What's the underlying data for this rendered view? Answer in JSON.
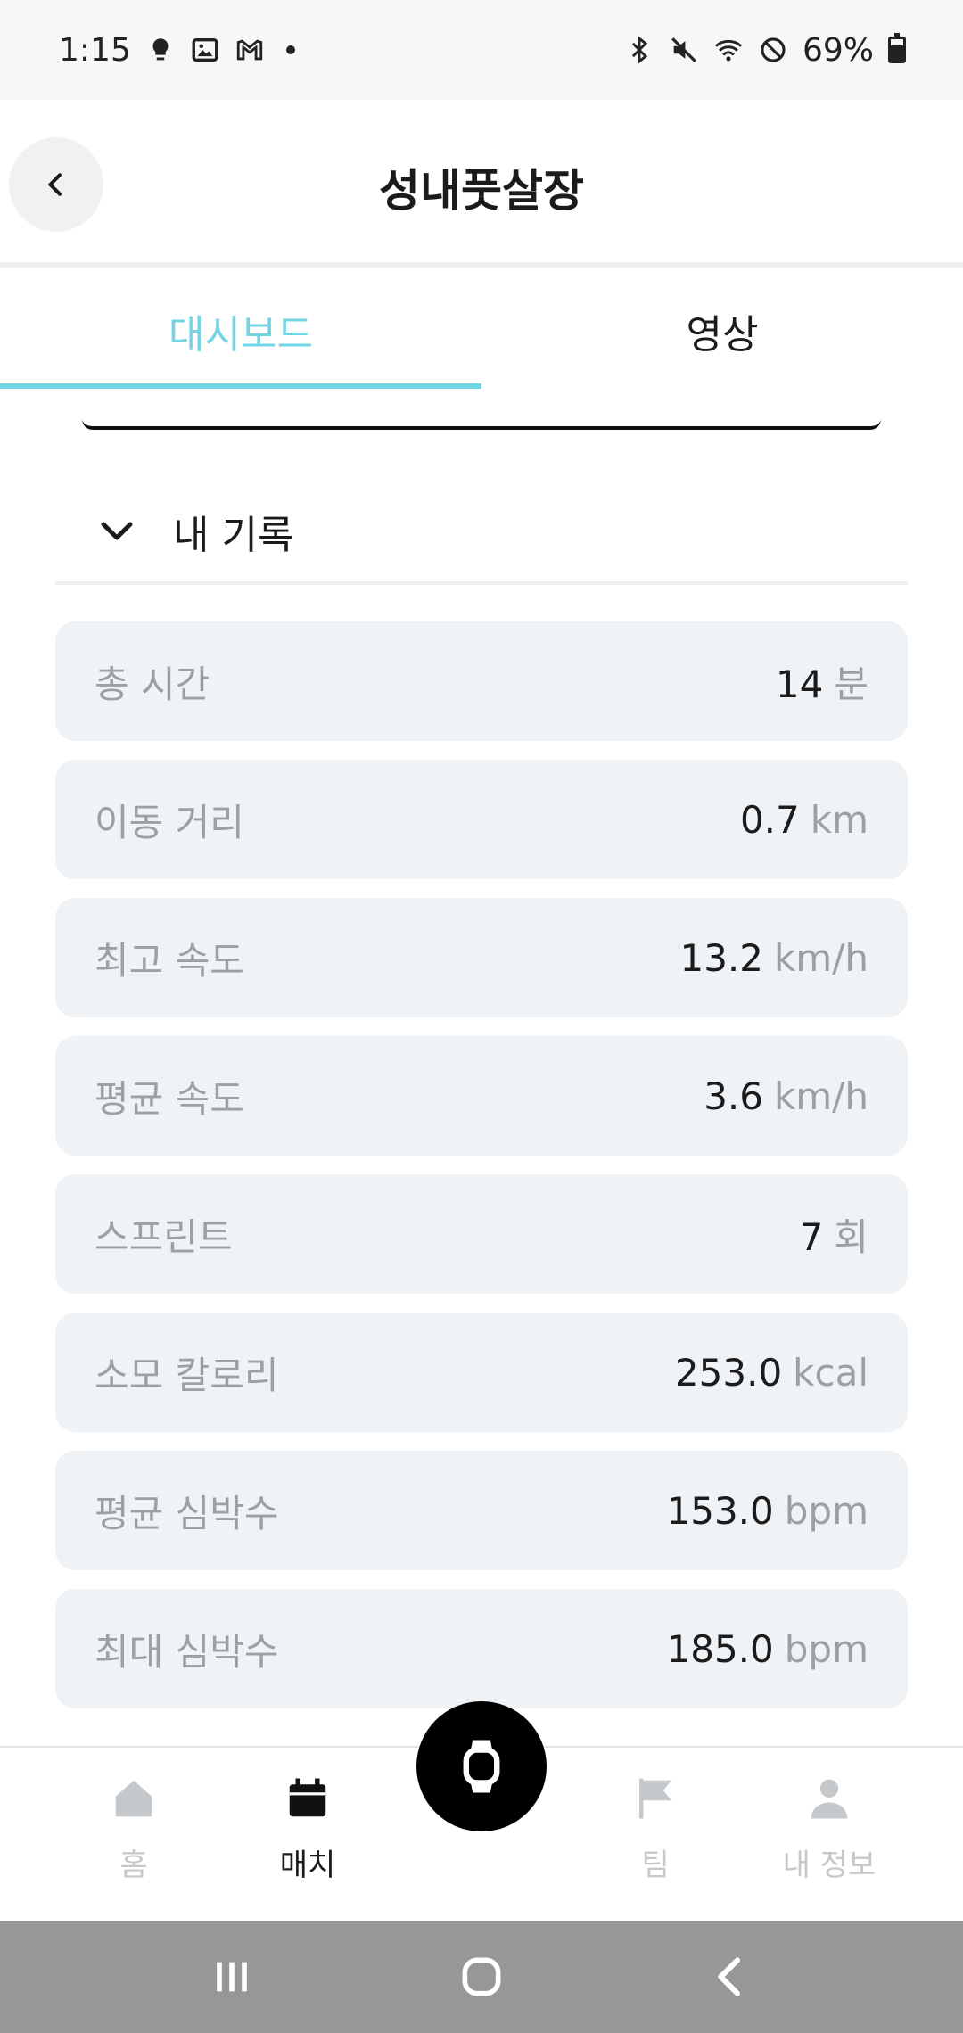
{
  "status_bar": {
    "time": "1:15",
    "battery": "69%",
    "left_icons": [
      "bulb-icon",
      "image-icon",
      "gmail-icon",
      "dot-icon"
    ],
    "right_icons": [
      "bluetooth-icon",
      "mute-icon",
      "wifi-icon",
      "do-not-disturb-icon",
      "battery-icon"
    ]
  },
  "header": {
    "title": "성내풋살장",
    "back_icon": "chevron-left-icon"
  },
  "tabs": [
    {
      "label": "대시보드",
      "active": true
    },
    {
      "label": "영상",
      "active": false
    }
  ],
  "section": {
    "title": "내 기록",
    "icon": "chevron-down-icon"
  },
  "stats": [
    {
      "label": "총 시간",
      "value": "14",
      "unit": "분"
    },
    {
      "label": "이동 거리",
      "value": "0.7",
      "unit": "km"
    },
    {
      "label": "최고 속도",
      "value": "13.2",
      "unit": "km/h"
    },
    {
      "label": "평균 속도",
      "value": "3.6",
      "unit": "km/h"
    },
    {
      "label": "스프린트",
      "value": "7",
      "unit": "회"
    },
    {
      "label": "소모 칼로리",
      "value": "253.0",
      "unit": "kcal"
    },
    {
      "label": "평균 심박수",
      "value": "153.0",
      "unit": "bpm"
    },
    {
      "label": "최대 심박수",
      "value": "185.0",
      "unit": "bpm"
    }
  ],
  "bottom_nav": {
    "items": [
      {
        "label": "홈",
        "icon": "home-icon",
        "active": false
      },
      {
        "label": "매치",
        "icon": "calendar-icon",
        "active": true
      },
      {
        "label": "팀",
        "icon": "flag-icon",
        "active": false
      },
      {
        "label": "내 정보",
        "icon": "person-icon",
        "active": false
      }
    ],
    "center_icon": "watch-icon"
  },
  "system_nav": [
    "recents-icon",
    "home-circle-icon",
    "back-icon"
  ],
  "colors": {
    "accent": "#72d5e3",
    "card_bg": "#f0f3f6",
    "muted_text": "#9aa0a6",
    "inactive_nav": "#c6c9cc"
  }
}
